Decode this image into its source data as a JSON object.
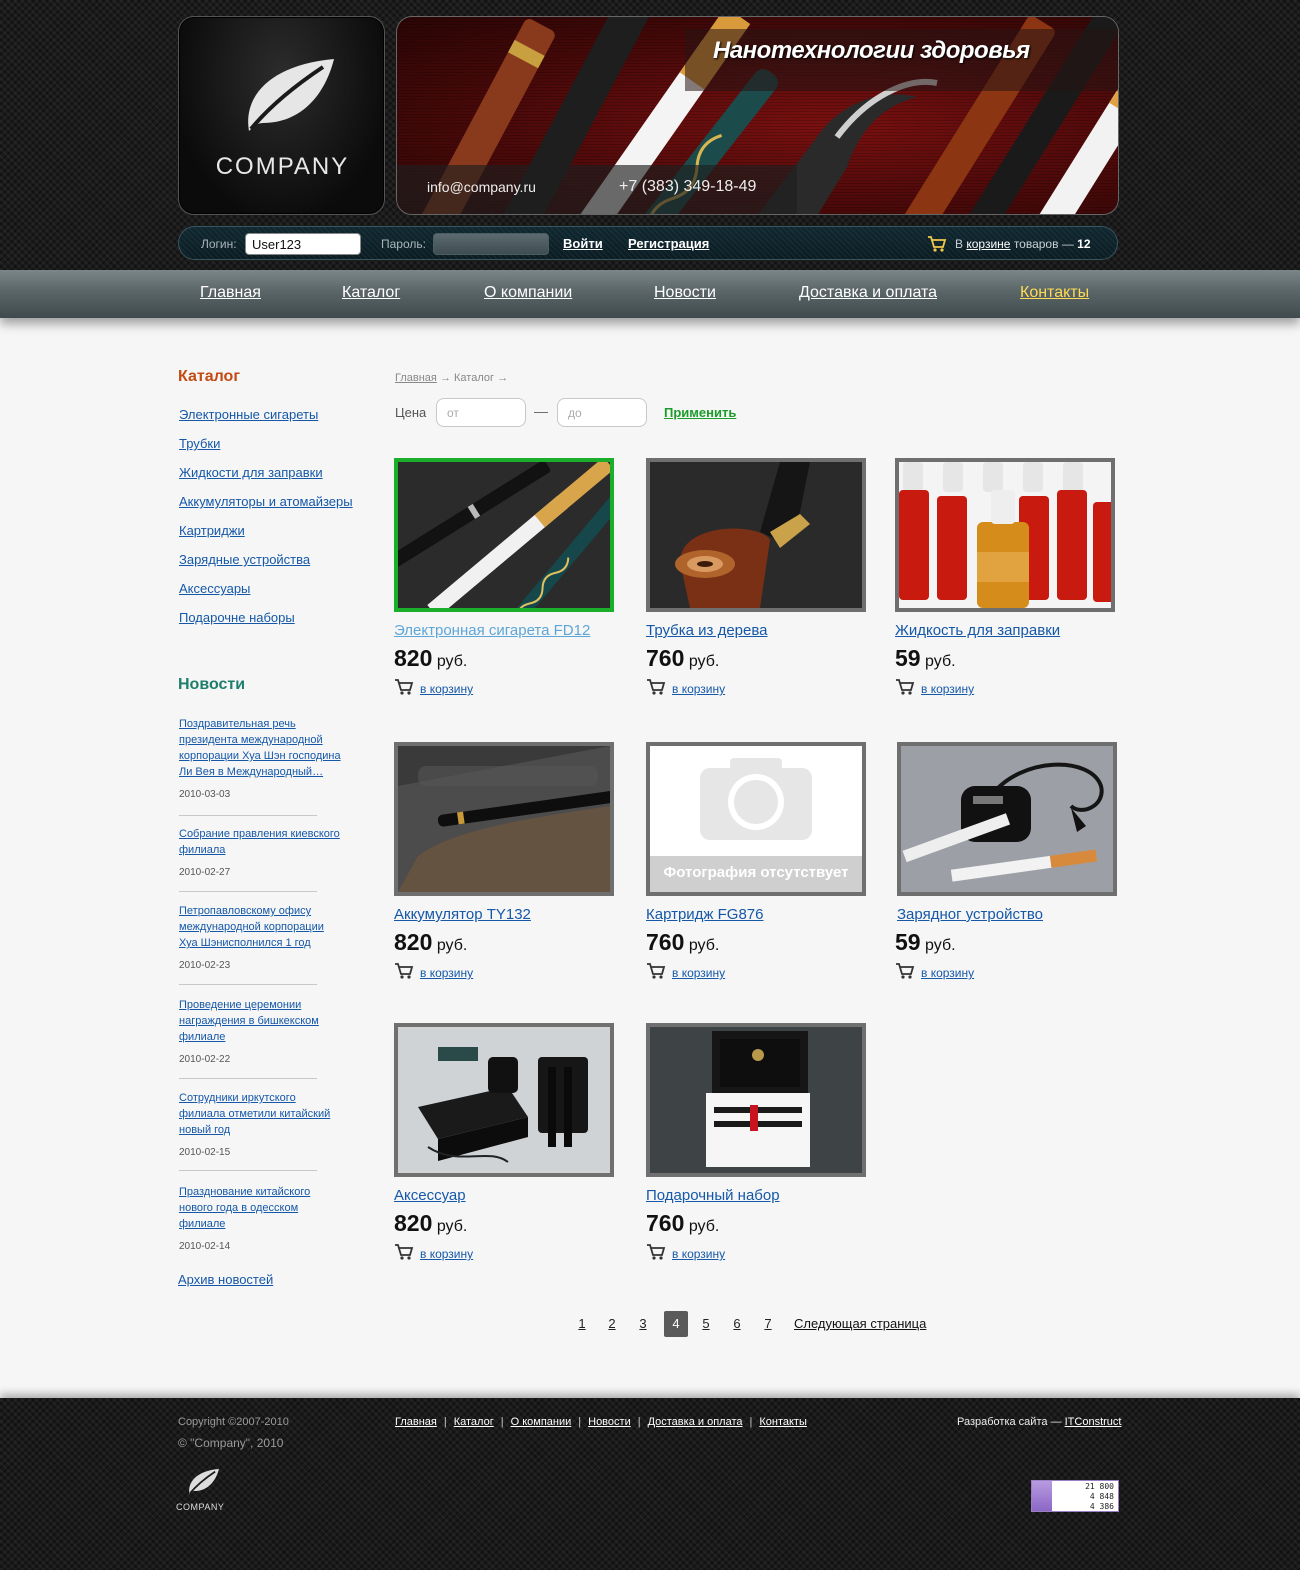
{
  "header": {
    "logo_text": "COMPANY",
    "banner_title": "Нанотехнологии здоровья",
    "email": "info@company.ru",
    "phone": "+7 (383) 349-18-49"
  },
  "login_bar": {
    "login_label": "Логин:",
    "login_value": "User123",
    "password_label": "Пароль:",
    "login_button": "Войти",
    "register_link": "Регистрация",
    "cart_prefix": "В",
    "cart_link": "корзине",
    "cart_middle": "товаров —",
    "cart_count": "12"
  },
  "nav": {
    "items": [
      {
        "label": "Главная"
      },
      {
        "label": "Каталог"
      },
      {
        "label": "О компании"
      },
      {
        "label": "Новости"
      },
      {
        "label": "Доставка и оплата"
      },
      {
        "label": "Контакты",
        "active": true
      }
    ]
  },
  "sidebar": {
    "catalog_heading": "Каталог",
    "catalog_items": [
      "Электронные сигареты",
      "Трубки",
      "Жидкости для заправки",
      "Аккумуляторы и атомайзеры",
      "Картриджи",
      "Зарядные устройства",
      "Аксессуары",
      "Подарочне наборы"
    ],
    "news_heading": "Новости",
    "news": [
      {
        "title": "Поздравительная речь президента международной корпорации Хуа Шэн господина Ли Вея в Международный…",
        "date": "2010-03-03"
      },
      {
        "title": "Собрание правления киевского филиала",
        "date": "2010-02-27"
      },
      {
        "title": "Петропавловскому офису международной корпорации Хуа Шэнисполнился 1 год",
        "date": "2010-02-23"
      },
      {
        "title": "Проведение церемонии награждения в бишкекском филиале",
        "date": "2010-02-22"
      },
      {
        "title": "Сотрудники иркутского филиала отметили китайский новый год",
        "date": "2010-02-15"
      },
      {
        "title": "Празднование китайского нового года в одесском филиале",
        "date": "2010-02-14"
      }
    ],
    "archive_link": "Архив новостей"
  },
  "breadcrumb": {
    "home": "Главная",
    "arrow": "→",
    "current": "Каталог"
  },
  "filter": {
    "label": "Цена",
    "from_placeholder": "от",
    "dash": "—",
    "to_placeholder": "до",
    "apply": "Применить"
  },
  "products": [
    {
      "name": "Электронная сигарета FD12",
      "price": "820",
      "currency": "руб.",
      "cart": "в корзину",
      "image": "e-cigarettes",
      "selected": true,
      "visited": true
    },
    {
      "name": "Трубка из дерева",
      "price": "760",
      "currency": "руб.",
      "cart": "в корзину",
      "image": "wooden-pipe"
    },
    {
      "name": "Жидкость для заправки",
      "price": "59",
      "currency": "руб.",
      "cart": "в корзину",
      "image": "liquid-bottles"
    },
    {
      "name": "Аккумулятор TY132",
      "price": "820",
      "currency": "руб.",
      "cart": "в корзину",
      "image": "battery"
    },
    {
      "name": "Картридж FG876",
      "price": "760",
      "currency": "руб.",
      "cart": "в корзину",
      "image": "no-photo",
      "no_photo_text": "Фотография отсутствует"
    },
    {
      "name": "Зарядног устройство",
      "price": "59",
      "currency": "руб.",
      "cart": "в корзину",
      "image": "charger"
    },
    {
      "name": "Аксессуар",
      "price": "820",
      "currency": "руб.",
      "cart": "в корзину",
      "image": "accessory-kit"
    },
    {
      "name": "Подарочный набор",
      "price": "760",
      "currency": "руб.",
      "cart": "в корзину",
      "image": "gift-set"
    }
  ],
  "pagination": {
    "pages": [
      "1",
      "2",
      "3",
      "4",
      "5",
      "6",
      "7"
    ],
    "current": "4",
    "next": "Следующая страница"
  },
  "footer": {
    "copyright1": "Copyright ©2007-2010",
    "copyright2": "© \"Company\", 2010",
    "nav": [
      "Главная",
      "Каталог",
      "О компании",
      "Новости",
      "Доставка и оплата",
      "Контакты"
    ],
    "dev_prefix": "Разработка сайта —",
    "dev_link": "ITConstruct",
    "logo_text": "COMPANY",
    "counter": [
      "21 800",
      "4 848",
      "4 386"
    ]
  }
}
